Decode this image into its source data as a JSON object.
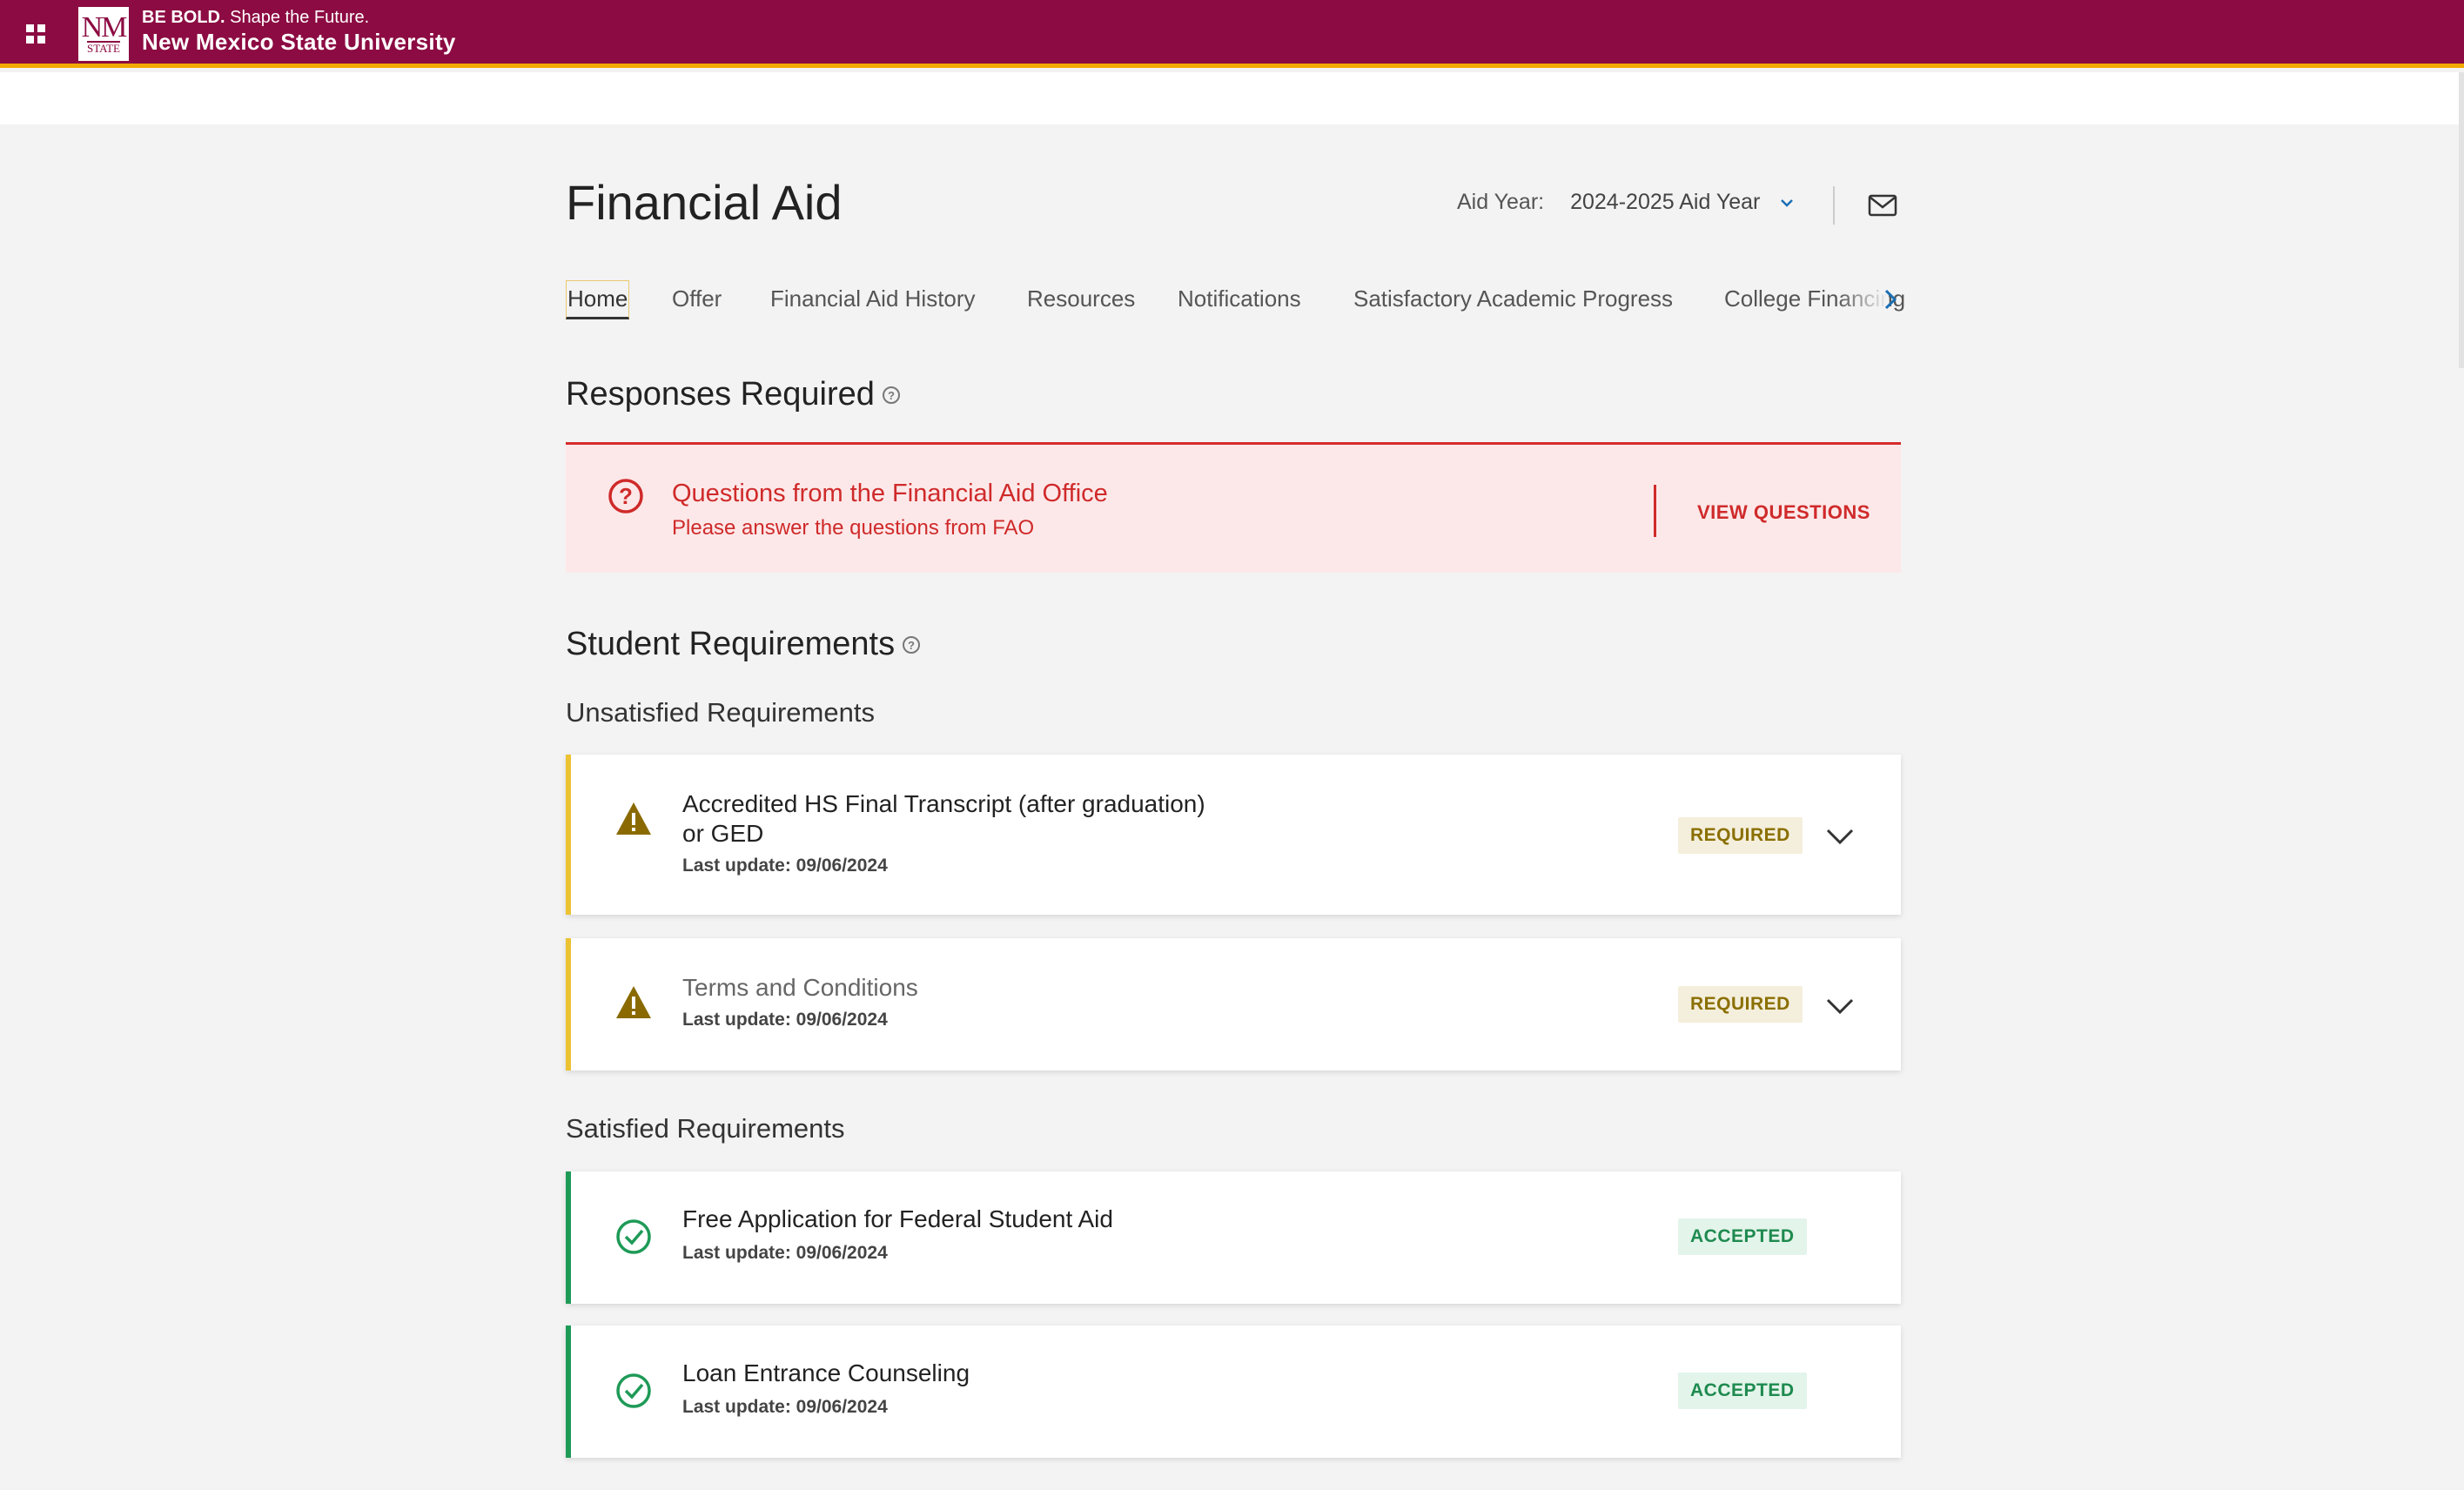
{
  "topbar": {
    "logo_nm": "NM",
    "logo_state": "STATE",
    "tag_bold": "BE BOLD.",
    "tag_rest": " Shape the Future.",
    "university": "New Mexico State University",
    "brand_color": "#8c0b42",
    "accent_color": "#f2a900"
  },
  "header": {
    "title": "Financial Aid",
    "aid_year_label": "Aid Year:",
    "aid_year_value": "2024-2025 Aid Year"
  },
  "tabs": [
    {
      "label": "Home",
      "active": true
    },
    {
      "label": "Offer"
    },
    {
      "label": "Financial Aid History"
    },
    {
      "label": "Resources"
    },
    {
      "label": "Notifications"
    },
    {
      "label": "Satisfactory Academic Progress"
    },
    {
      "label": "College Financing Plan"
    }
  ],
  "responses": {
    "title": "Responses Required",
    "alert_title": "Questions from the Financial Aid Office",
    "alert_sub": "Please answer the questions from FAO",
    "alert_button": "VIEW QUESTIONS"
  },
  "requirements": {
    "title": "Student Requirements",
    "unsatisfied_title": "Unsatisfied Requirements",
    "satisfied_title": "Satisfied Requirements",
    "unsatisfied": [
      {
        "line1": "Accredited HS Final Transcript (after graduation)",
        "line2": "or GED",
        "date": "Last update: 09/06/2024",
        "status": "REQUIRED"
      },
      {
        "line1": "Terms and Conditions",
        "date": "Last update: 09/06/2024",
        "status": "REQUIRED"
      }
    ],
    "satisfied": [
      {
        "line1": "Free Application for Federal Student Aid",
        "date": "Last update: 09/06/2024",
        "status": "ACCEPTED"
      },
      {
        "line1": "Loan Entrance Counseling",
        "date": "Last update: 09/06/2024",
        "status": "ACCEPTED"
      }
    ]
  },
  "icons": {
    "apps": "grid-icon",
    "dropdown": "chevron-down-icon",
    "contact": "mail-icon",
    "next_tab": "chevron-right-icon",
    "help": "help-circle-icon",
    "warning": "warning-triangle-icon",
    "accepted": "check-circle-icon",
    "expand": "chevron-down-icon"
  },
  "colors": {
    "alert_red": "#cf2a2a",
    "warning_yellow": "#ecc233",
    "success_green": "#1e9a57"
  }
}
